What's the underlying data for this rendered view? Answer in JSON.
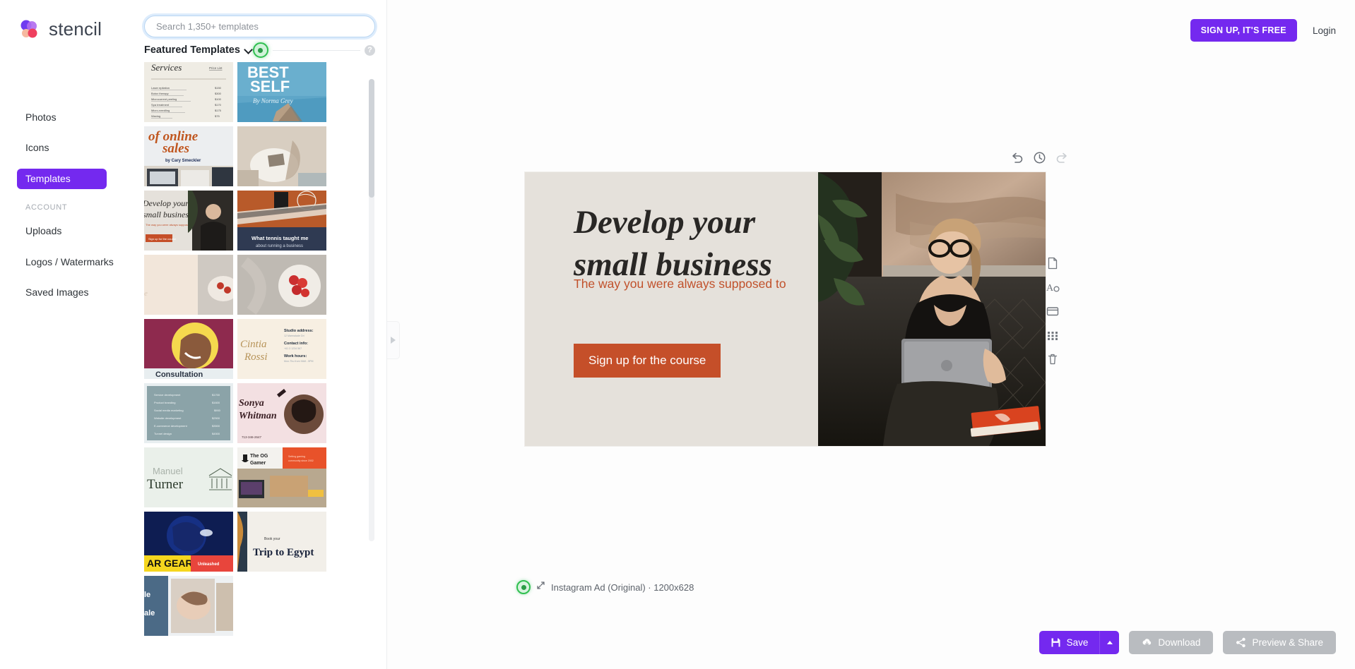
{
  "brand": {
    "name": "stencil"
  },
  "search": {
    "placeholder": "Search 1,350+ templates",
    "value": ""
  },
  "panel": {
    "featured_label": "Featured Templates",
    "help_icon": "question-circle-icon",
    "chevron_icon": "chevron-down-icon"
  },
  "sidebar": {
    "items": [
      {
        "label": "Photos",
        "active": false
      },
      {
        "label": "Icons",
        "active": false
      },
      {
        "label": "Templates",
        "active": true
      }
    ],
    "section_label": "ACCOUNT",
    "account_items": [
      {
        "label": "Uploads"
      },
      {
        "label": "Logos / Watermarks"
      },
      {
        "label": "Saved Images"
      }
    ]
  },
  "templates": [
    {
      "name": "services-price-list",
      "title": "Services",
      "subtitle": "Price List"
    },
    {
      "name": "best-self",
      "title": "BEST SELF",
      "subtitle": "By Norma Grey"
    },
    {
      "name": "of-online-sales",
      "title": "of online sales",
      "subtitle": "by Cary Smeckler"
    },
    {
      "name": "workspace-photo",
      "title": "",
      "subtitle": ""
    },
    {
      "name": "develop-small-business",
      "title": "Develop your small business",
      "subtitle": "Sign up for the course"
    },
    {
      "name": "what-tennis-taught-me",
      "title": "What tennis taught me",
      "subtitle": ""
    },
    {
      "name": "beige-blank",
      "title": "",
      "subtitle": ""
    },
    {
      "name": "berries-plate",
      "title": "",
      "subtitle": ""
    },
    {
      "name": "consultation-portrait",
      "title": "Consultation",
      "subtitle": ""
    },
    {
      "name": "cintia-rossi",
      "title": "Cintia Rossi",
      "subtitle": "Studio address: Contact info: Work hours:"
    },
    {
      "name": "price-table-teal",
      "title": "",
      "subtitle": "Service development $1700 / Product branding $1600 / Social media marketing $900 / Website development $2500 / E-commerce development $3500 / Tunnel design $4500"
    },
    {
      "name": "sonya-whitman",
      "title": "Sonya Whitman",
      "subtitle": "713-346-2647"
    },
    {
      "name": "manuel-turner",
      "title": "Manuel Turner",
      "subtitle": ""
    },
    {
      "name": "the-og-gamer",
      "title": "The OG Gamer",
      "subtitle": ""
    },
    {
      "name": "ar-gear",
      "title": "AR GEAR",
      "subtitle": "Unleashed"
    },
    {
      "name": "trip-to-egypt",
      "title": "Trip to Egypt",
      "subtitle": "Book your"
    },
    {
      "name": "baby-sale",
      "title": "Sale",
      "subtitle": ""
    }
  ],
  "topbar": {
    "signup_label": "SIGN UP, IT'S FREE",
    "login_label": "Login"
  },
  "canvas_controls": [
    {
      "name": "undo-icon",
      "enabled": true
    },
    {
      "name": "history-clock-icon",
      "enabled": true
    },
    {
      "name": "redo-icon",
      "enabled": false
    }
  ],
  "canvas": {
    "headline": "Develop your small business",
    "subhead": "The way you were always supposed to",
    "cta_label": "Sign up for the course",
    "background": "#e5e1db",
    "accent": "#c54f29",
    "caption": "Instagram Ad (Original) · 1200x628",
    "caption_size": "1200x628",
    "caption_name": "Instagram Ad (Original)"
  },
  "right_tools": [
    {
      "name": "page-icon"
    },
    {
      "name": "text-tool-icon"
    },
    {
      "name": "frame-icon"
    },
    {
      "name": "grid-icon"
    },
    {
      "name": "trash-icon"
    }
  ],
  "actions": {
    "save_label": "Save",
    "save_caret_icon": "chevron-up-icon",
    "download_label": "Download",
    "preview_label": "Preview & Share"
  },
  "colors": {
    "brand_purple": "#7429ef",
    "cursor_green": "#2fbf4f",
    "canvas_beige": "#e5e1db",
    "cta_orange": "#c54f29",
    "disabled_gray": "#b9bcc0"
  }
}
